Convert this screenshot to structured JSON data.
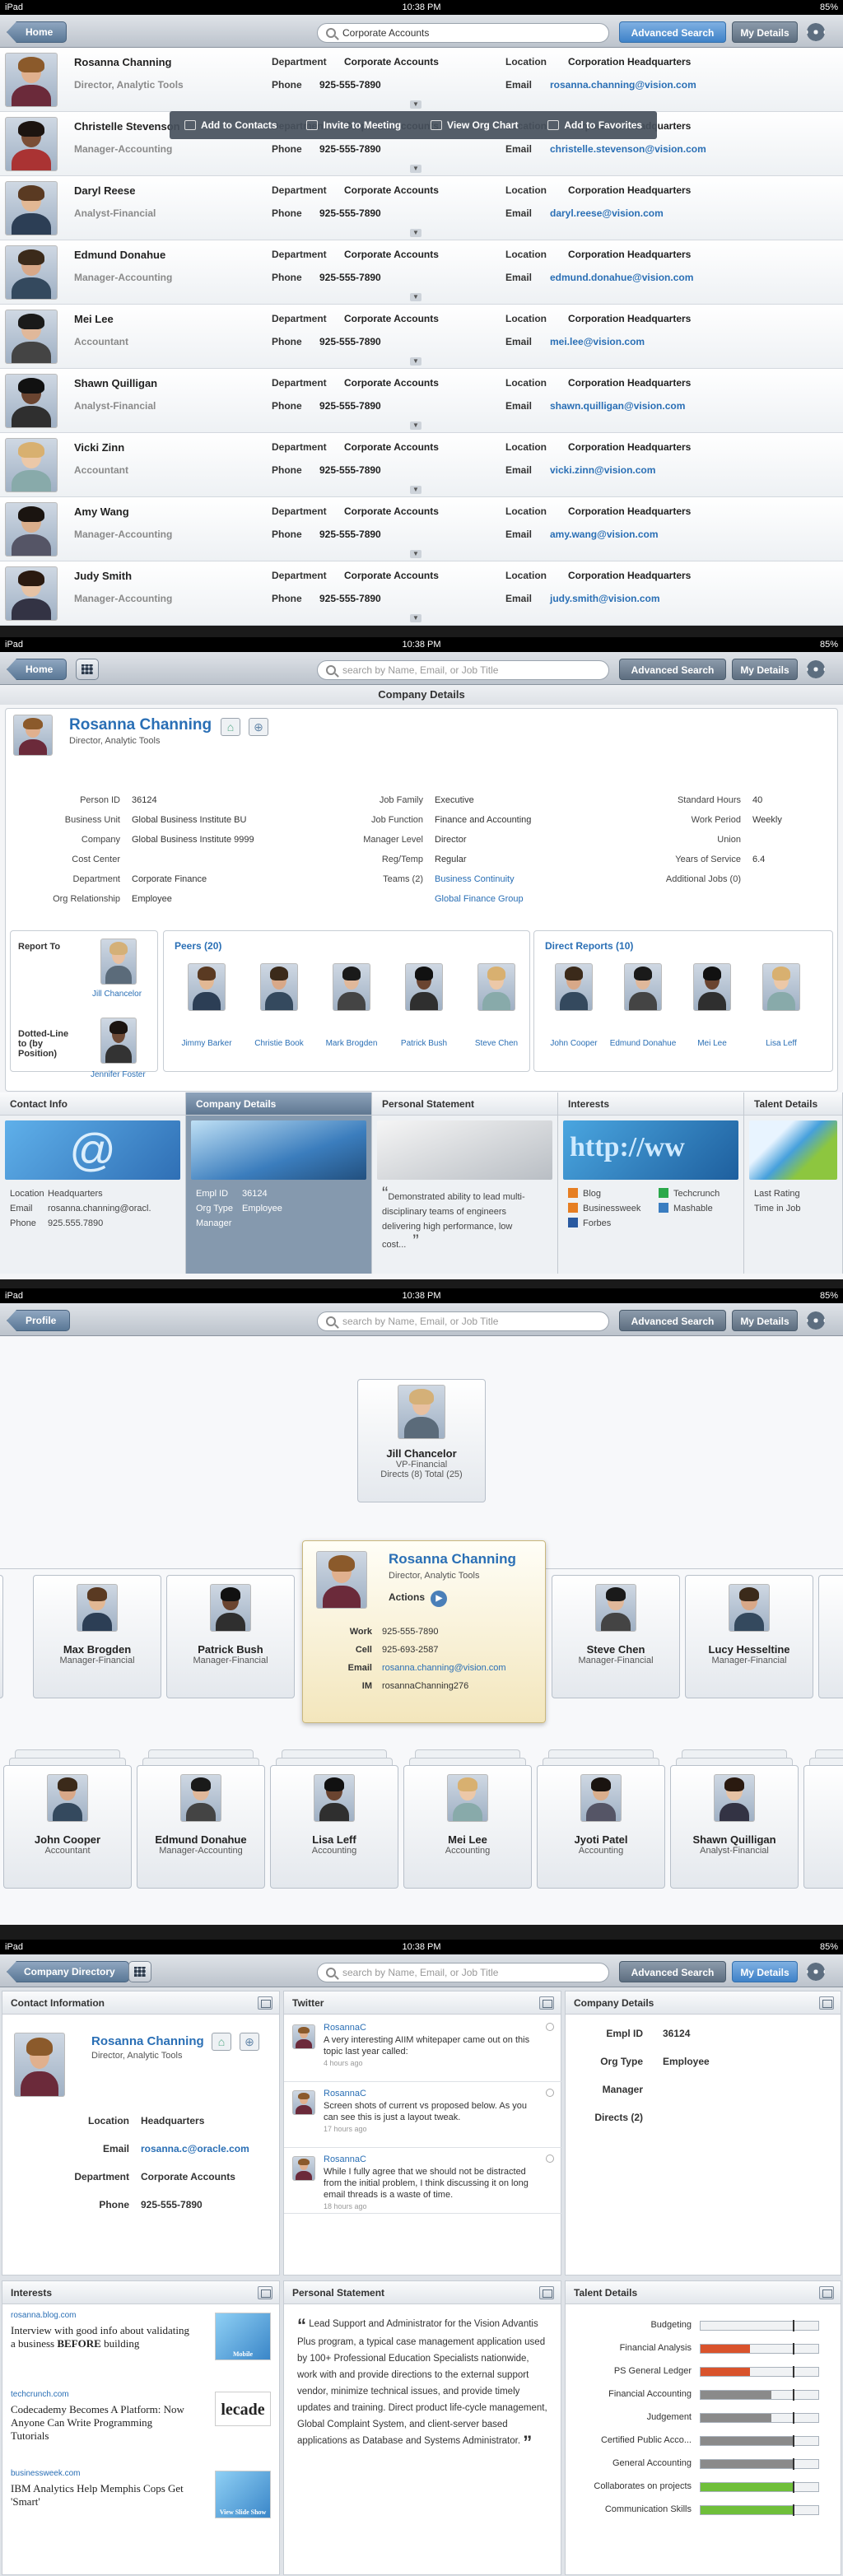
{
  "status": {
    "device": "iPad",
    "time": "10:38 PM",
    "battery": "85%"
  },
  "nav1": {
    "back": "Home",
    "search_value": "Corporate Accounts",
    "advanced": "Advanced Search",
    "my_details": "My Details"
  },
  "labels": {
    "department": "Department",
    "location": "Location",
    "phone": "Phone",
    "email": "Email"
  },
  "people": [
    {
      "name": "Rosanna Channing",
      "title": "Director, Analytic Tools",
      "dept": "Corporate Accounts",
      "loc": "Corporation Headquarters",
      "phone": "925-555-7890",
      "email": "rosanna.channing@vision.com"
    },
    {
      "name": "Christelle Stevenson",
      "title": "Manager-Accounting",
      "dept": "Corporate Accounts",
      "loc": "Corporation Headquarters",
      "phone": "925-555-7890",
      "email": "christelle.stevenson@vision.com"
    },
    {
      "name": "Daryl Reese",
      "title": "Analyst-Financial",
      "dept": "Corporate Accounts",
      "loc": "Corporation Headquarters",
      "phone": "925-555-7890",
      "email": "daryl.reese@vision.com"
    },
    {
      "name": "Edmund Donahue",
      "title": "Manager-Accounting",
      "dept": "Corporate Accounts",
      "loc": "Corporation Headquarters",
      "phone": "925-555-7890",
      "email": "edmund.donahue@vision.com"
    },
    {
      "name": "Mei Lee",
      "title": "Accountant",
      "dept": "Corporate Accounts",
      "loc": "Corporation Headquarters",
      "phone": "925-555-7890",
      "email": "mei.lee@vision.com"
    },
    {
      "name": "Shawn Quilligan",
      "title": "Analyst-Financial",
      "dept": "Corporate Accounts",
      "loc": "Corporation Headquarters",
      "phone": "925-555-7890",
      "email": "shawn.quilligan@vision.com"
    },
    {
      "name": "Vicki Zinn",
      "title": "Accountant",
      "dept": "Corporate Accounts",
      "loc": "Corporation Headquarters",
      "phone": "925-555-7890",
      "email": "vicki.zinn@vision.com"
    },
    {
      "name": "Amy Wang",
      "title": "Manager-Accounting",
      "dept": "Corporate Accounts",
      "loc": "Corporation Headquarters",
      "phone": "925-555-7890",
      "email": "amy.wang@vision.com"
    },
    {
      "name": "Judy Smith",
      "title": "Manager-Accounting",
      "dept": "Corporate Accounts",
      "loc": "Corporation Headquarters",
      "phone": "925-555-7890",
      "email": "judy.smith@vision.com"
    }
  ],
  "actions": [
    "Add to Contacts",
    "Invite to Meeting",
    "View Org Chart",
    "Add to Favorites"
  ],
  "nav2": {
    "back": "Home",
    "search_placeholder": "search by Name, Email, or Job Title",
    "advanced": "Advanced Search",
    "my_details": "My Details",
    "title": "Company Details"
  },
  "profile": {
    "name": "Rosanna Channing",
    "title": "Director, Analytic Tools"
  },
  "details": {
    "col1": [
      [
        "Person ID",
        "36124"
      ],
      [
        "Business Unit",
        "Global Business Institute BU"
      ],
      [
        "Company",
        "Global Business Institute 9999"
      ],
      [
        "Cost Center",
        ""
      ],
      [
        "Department",
        "Corporate Finance"
      ],
      [
        "Org Relationship",
        "Employee"
      ]
    ],
    "col2": [
      [
        "Job Family",
        "Executive"
      ],
      [
        "Job Function",
        "Finance and Accounting"
      ],
      [
        "Manager Level",
        "Director"
      ],
      [
        "Reg/Temp",
        "Regular"
      ],
      [
        "Teams (2)",
        "Business Continuity"
      ],
      [
        "",
        "Global Finance Group"
      ]
    ],
    "col3": [
      [
        "Standard Hours",
        "40"
      ],
      [
        "Work Period",
        "Weekly"
      ],
      [
        "Union",
        ""
      ],
      [
        "Years of Service",
        "6.4"
      ],
      [
        "Additional Jobs (0)",
        ""
      ]
    ]
  },
  "report": {
    "report_to": "Report To",
    "report_name": "Jill Chancelor",
    "dotted": "Dotted-Line to (by Position)",
    "dotted_name": "Jennifer Foster"
  },
  "peers": {
    "title": "Peers (20)",
    "names": [
      "Jimmy Barker",
      "Christie Book",
      "Mark Brogden",
      "Patrick Bush",
      "Steve Chen"
    ]
  },
  "directs": {
    "title": "Direct Reports (10)",
    "names": [
      "John Cooper",
      "Edmund Donahue",
      "Mei Lee",
      "Lisa Leff"
    ]
  },
  "tiles": {
    "contact": {
      "title": "Contact Info",
      "lines": [
        [
          "Location",
          "Headquarters"
        ],
        [
          "Email",
          "rosanna.channing@oracl."
        ],
        [
          "Phone",
          "925.555.7890"
        ]
      ]
    },
    "company": {
      "title": "Company Details",
      "lines": [
        [
          "Empl ID",
          "36124"
        ],
        [
          "Org Type",
          "Employee"
        ],
        [
          "Manager",
          ""
        ]
      ]
    },
    "statement": {
      "title": "Personal Statement",
      "text": "Demonstrated ability to lead multi-disciplinary teams of engineers delivering high performance, low cost..."
    },
    "interests": {
      "title": "Interests",
      "items": [
        "Blog",
        "Techcrunch",
        "Businessweek",
        "Mashable",
        "Forbes"
      ]
    },
    "talent": {
      "title": "Talent Details",
      "lines": [
        "Last Rating",
        "Time in Job"
      ]
    }
  },
  "nav3": {
    "back": "Profile",
    "search_placeholder": "search by Name, Email, or Job Title",
    "advanced": "Advanced Search",
    "my_details": "My Details"
  },
  "org": {
    "manager": {
      "name": "Jill Chancelor",
      "title": "VP-Financial",
      "directs": "Directs (8) Total (25)"
    },
    "left_peers": [
      {
        "name": "Max Brogden",
        "title": "Manager-Financial"
      },
      {
        "name": "Patrick Bush",
        "title": "Manager-Financial"
      }
    ],
    "right_peers": [
      {
        "name": "Steve Chen",
        "title": "Manager-Financial"
      },
      {
        "name": "Lucy Hesseltine",
        "title": "Manager-Financial"
      }
    ],
    "focus": {
      "name": "Rosanna Channing",
      "title": "Director, Analytic Tools",
      "actions": "Actions",
      "work_label": "Work",
      "work": "925-555-7890",
      "cell_label": "Cell",
      "cell": "925-693-2587",
      "email_label": "Email",
      "email": "rosanna.channing@vision.com",
      "im_label": "IM",
      "im": "rosannaChanning276"
    },
    "reports": [
      {
        "name": "John Cooper",
        "title": "Accountant"
      },
      {
        "name": "Edmund Donahue",
        "title": "Manager-Accounting"
      },
      {
        "name": "Lisa Leff",
        "title": "Accounting"
      },
      {
        "name": "Mei Lee",
        "title": "Accounting"
      },
      {
        "name": "Jyoti Patel",
        "title": "Accounting"
      },
      {
        "name": "Shawn Quilligan",
        "title": "Analyst-Financial"
      },
      {
        "name": "Da",
        "title": "Ana"
      }
    ]
  },
  "nav4": {
    "back": "Company Directory",
    "search_placeholder": "search by Name, Email, or Job Title",
    "advanced": "Advanced Search",
    "my_details": "My Details"
  },
  "dash": {
    "contact": {
      "title": "Contact Information",
      "name": "Rosanna Channing",
      "subtitle": "Director, Analytic Tools",
      "rows": [
        [
          "Location",
          "Headquarters"
        ],
        [
          "Email",
          "rosanna.c@oracle.com"
        ],
        [
          "Department",
          "Corporate Accounts"
        ],
        [
          "Phone",
          "925-555-7890"
        ]
      ]
    },
    "twitter": {
      "title": "Twitter",
      "tweets": [
        {
          "user": "RosannaC",
          "text": "A very interesting AIIM whitepaper came out on this topic last year called:",
          "time": "4 hours ago"
        },
        {
          "user": "RosannaC",
          "text": "Screen shots of current vs proposed below. As you can see this is just a layout tweak.",
          "time": "17 hours ago"
        },
        {
          "user": "RosannaC",
          "text": "While I fully agree that we should not be distracted from the initial problem, I think discussing it on long email threads is a waste of time.",
          "time": "18 hours ago"
        }
      ]
    },
    "company": {
      "title": "Company Details",
      "rows": [
        [
          "Empl ID",
          "36124"
        ],
        [
          "Org Type",
          "Employee"
        ],
        [
          "Manager",
          ""
        ],
        [
          "Directs (2)",
          ""
        ]
      ]
    },
    "interests": {
      "title": "Interests",
      "items": [
        {
          "source": "rosanna.blog.com",
          "text_a": "Interview with good info about validating a business ",
          "text_b": "BEFORE",
          "text_c": " building",
          "thumb": "Mobile"
        },
        {
          "source": "techcrunch.com",
          "text_a": "Codecademy Becomes A Platform: Now Anyone Can Write Programming Tutorials",
          "text_b": "",
          "text_c": "",
          "thumb": "lecade"
        },
        {
          "source": "businessweek.com",
          "text_a": "IBM Analytics Help Memphis Cops Get 'Smart'",
          "text_b": "",
          "text_c": "",
          "thumb": "View Slide Show"
        }
      ]
    },
    "statement": {
      "title": "Personal Statement",
      "text": "Lead Support and Administrator for the Vision Advantis Plus program, a typical case management application used by 100+ Professional Education Specialists nationwide, work with and provide directions to the external support vendor, minimize technical issues, and provide timely updates and training. Direct product life-cycle management, Global Complaint System, and client-server based applications as Database and Systems Administrator."
    },
    "talent": {
      "title": "Talent Details",
      "skills": [
        {
          "name": "Budgeting",
          "level": 0,
          "color": "#888"
        },
        {
          "name": "Financial Analysis",
          "level": 0.42,
          "color": "#d9532c"
        },
        {
          "name": "PS General Ledger",
          "level": 0.42,
          "color": "#d9532c"
        },
        {
          "name": "Financial Accounting",
          "level": 0.6,
          "color": "#8a8a8a"
        },
        {
          "name": "Judgement",
          "level": 0.6,
          "color": "#8a8a8a"
        },
        {
          "name": "Certified Public Acco...",
          "level": 0.8,
          "color": "#8a8a8a"
        },
        {
          "name": "General Accounting",
          "level": 0.8,
          "color": "#8a8a8a"
        },
        {
          "name": "Collaborates on projects",
          "level": 0.8,
          "color": "#6fbf3a"
        },
        {
          "name": "Communication Skills",
          "level": 0.8,
          "color": "#6fbf3a"
        }
      ]
    }
  }
}
